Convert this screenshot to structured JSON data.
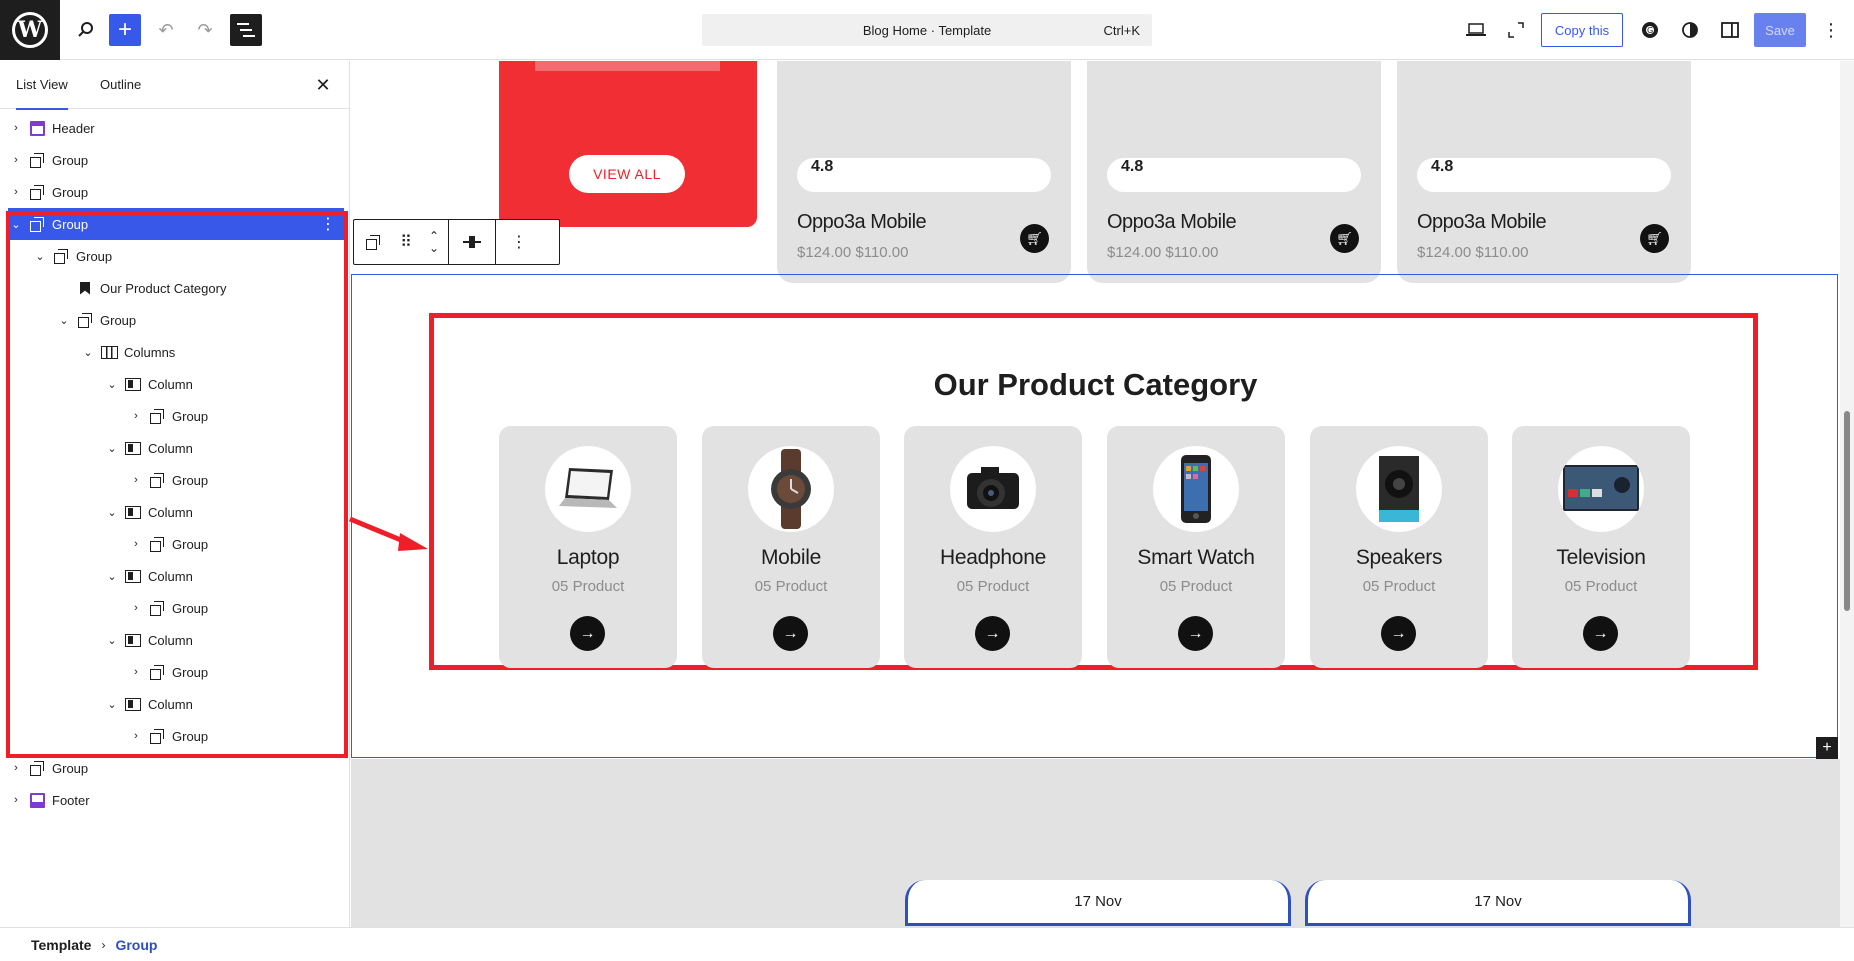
{
  "topbar": {
    "command_title": "Blog Home · Template",
    "command_shortcut": "Ctrl+K",
    "copy_label": "Copy this",
    "save_label": "Save",
    "accent": "#3858e9"
  },
  "sidebar": {
    "tabs": [
      "List View",
      "Outline"
    ],
    "rows": [
      {
        "label": "Header",
        "icon": "template-part-header-icon"
      },
      {
        "label": "Group",
        "icon": "group-icon"
      },
      {
        "label": "Group",
        "icon": "group-icon"
      },
      {
        "label": "Group",
        "icon": "group-icon",
        "selected": true
      },
      {
        "label": "Group",
        "icon": "group-icon"
      },
      {
        "label": "Our Product Category",
        "icon": "heading-bookmark-icon"
      },
      {
        "label": "Group",
        "icon": "group-icon"
      },
      {
        "label": "Columns",
        "icon": "columns-icon"
      },
      {
        "label": "Column",
        "icon": "column-icon"
      },
      {
        "label": "Group",
        "icon": "group-icon"
      },
      {
        "label": "Column",
        "icon": "column-icon"
      },
      {
        "label": "Group",
        "icon": "group-icon"
      },
      {
        "label": "Column",
        "icon": "column-icon"
      },
      {
        "label": "Group",
        "icon": "group-icon"
      },
      {
        "label": "Column",
        "icon": "column-icon"
      },
      {
        "label": "Group",
        "icon": "group-icon"
      },
      {
        "label": "Column",
        "icon": "column-icon"
      },
      {
        "label": "Group",
        "icon": "group-icon"
      },
      {
        "label": "Column",
        "icon": "column-icon"
      },
      {
        "label": "Group",
        "icon": "group-icon"
      },
      {
        "label": "Group",
        "icon": "group-icon"
      },
      {
        "label": "Footer",
        "icon": "template-part-footer-icon"
      }
    ]
  },
  "canvas": {
    "view_all": "VIEW ALL",
    "products": [
      {
        "rating": "4.8",
        "name": "Oppo3a Mobile",
        "price": "$124.00 $110.00"
      },
      {
        "rating": "4.8",
        "name": "Oppo3a Mobile",
        "price": "$124.00 $110.00"
      },
      {
        "rating": "4.8",
        "name": "Oppo3a Mobile",
        "price": "$124.00 $110.00"
      }
    ],
    "category_title": "Our Product Category",
    "categories": [
      {
        "name": "Laptop",
        "count": "05 Product"
      },
      {
        "name": "Mobile",
        "count": "05 Product"
      },
      {
        "name": "Headphone",
        "count": "05 Product"
      },
      {
        "name": "Smart Watch",
        "count": "05 Product"
      },
      {
        "name": "Speakers",
        "count": "05 Product"
      },
      {
        "name": "Television",
        "count": "05 Product"
      }
    ],
    "dates": [
      "17 Nov",
      "17 Nov"
    ]
  },
  "breadcrumb": {
    "root": "Template",
    "current": "Group"
  },
  "colors": {
    "highlight_red": "#ee1f28",
    "card_grey": "#e2e2e2",
    "brand_red": "#f02e34"
  }
}
